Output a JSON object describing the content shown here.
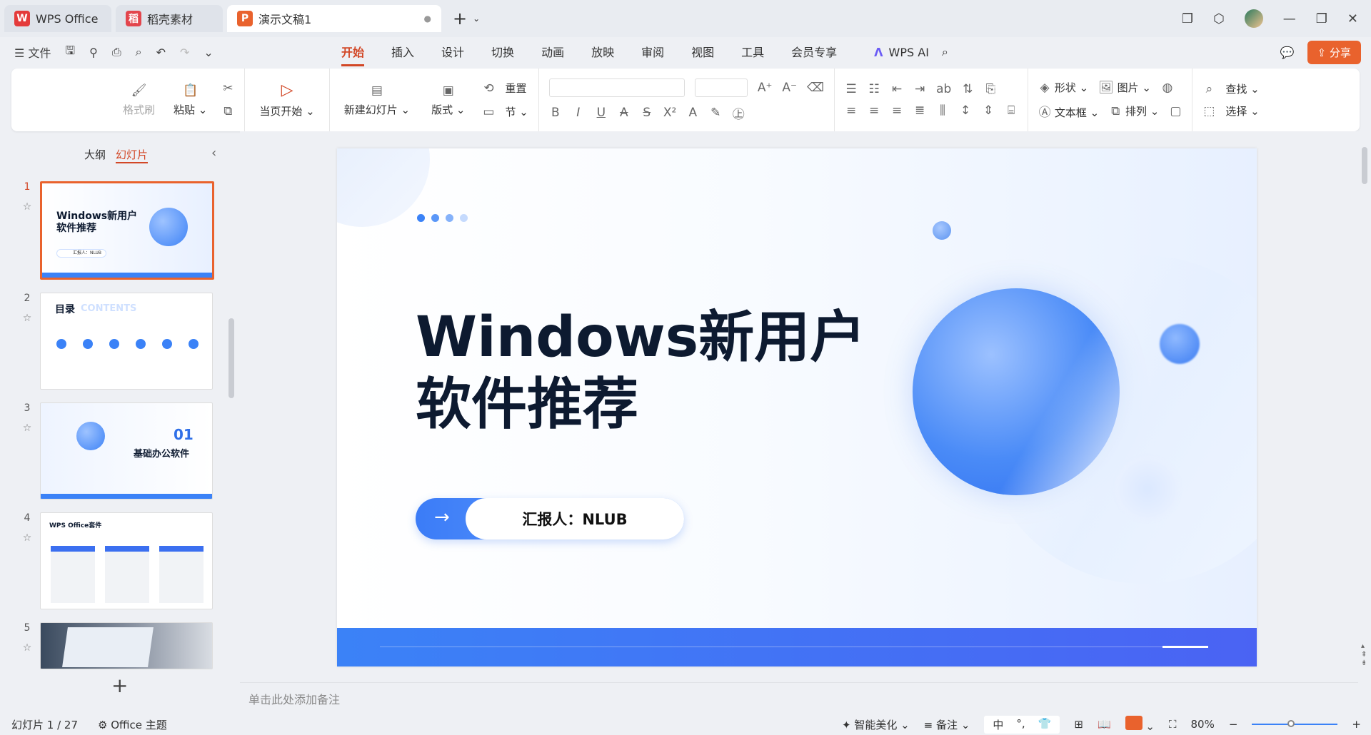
{
  "titlebar": {
    "tabs": [
      {
        "label": "WPS Office",
        "logo": "W",
        "color": "#e43b3b"
      },
      {
        "label": "稻壳素材",
        "logo": "稻",
        "color": "#e3454c"
      },
      {
        "label": "演示文稿1",
        "logo": "P",
        "color": "#e9622d"
      }
    ],
    "new_tab": "+",
    "window_controls": [
      "minimize-icon",
      "restore-icon",
      "close-icon"
    ]
  },
  "menubar": {
    "file": "文件",
    "tabs": [
      "开始",
      "插入",
      "设计",
      "切换",
      "动画",
      "放映",
      "审阅",
      "视图",
      "工具",
      "会员专享"
    ],
    "selected_tab": "开始",
    "ai_label": "WPS AI",
    "share": "分享"
  },
  "ribbon": {
    "format_painter": "格式刷",
    "paste": "粘贴",
    "start_from_current": "当页开始",
    "new_slide": "新建幻灯片",
    "layout": "版式",
    "reset": "重置",
    "section": "节",
    "shape": "形状",
    "picture": "图片",
    "find": "查找",
    "textbox": "文本框",
    "arrange": "排列",
    "select": "选择"
  },
  "sidebar": {
    "tabs": [
      "大纲",
      "幻灯片"
    ],
    "selected_tab": "幻灯片",
    "slides": [
      {
        "num": "1",
        "title": "Windows新用户\n软件推荐",
        "sub": "汇报人：NLUB"
      },
      {
        "num": "2",
        "title": "目录",
        "sub": "CONTENTS"
      },
      {
        "num": "3",
        "title": "01",
        "sub": "基础办公软件"
      },
      {
        "num": "4",
        "title": "WPS Office套件",
        "sub": ""
      },
      {
        "num": "5",
        "title": "",
        "sub": ""
      }
    ]
  },
  "slide": {
    "title_line1": "Windows新用户",
    "title_line2": "软件推荐",
    "reporter": "汇报人：NLUB"
  },
  "notes": {
    "placeholder": "单击此处添加备注"
  },
  "status": {
    "slide_count": "幻灯片 1 / 27",
    "theme": "Office 主题",
    "beautify": "智能美化",
    "notes_label": "备注",
    "ime": [
      "中",
      "°,",
      "👕"
    ],
    "zoom": "80%",
    "zoom_level": 0.45
  },
  "colors": {
    "accent": "#d24726",
    "share": "#e9622d",
    "blue": "#3b82f7"
  }
}
